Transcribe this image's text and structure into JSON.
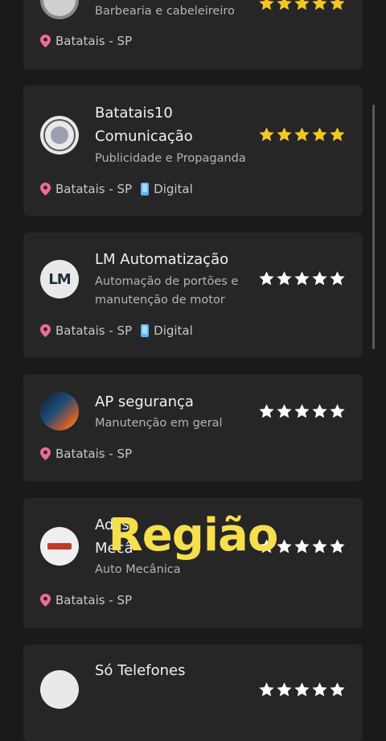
{
  "colors": {
    "background": "#1a1a1b",
    "card": "#262627",
    "star_gold": "#f3c623",
    "star_white": "#ffffff",
    "pin": "#f06a9e",
    "caption": "#f5df4d"
  },
  "listings": [
    {
      "name": "",
      "name_line2": "",
      "category": "Barbearia e cabeleireiro",
      "location": "Batatais - SP",
      "digital": "",
      "rating": 5,
      "star_color": "gold",
      "avatar_icon": "barbershop-logo-icon"
    },
    {
      "name": "Batatais10",
      "name_line2": "Comunicação",
      "category": "Publicidade e Propaganda",
      "location": "Batatais - SP",
      "digital": "Digital",
      "rating": 5,
      "star_color": "gold",
      "avatar_icon": "batatais10-logo-icon"
    },
    {
      "name": "LM Automatização",
      "name_line2": "",
      "category": "Automação de portões e",
      "category_line2": "manutenção de motor",
      "location": "Batatais - SP",
      "digital": "Digital",
      "rating": 5,
      "star_color": "white",
      "avatar_icon": "lm-logo-icon"
    },
    {
      "name": "AP segurança",
      "name_line2": "",
      "category": "Manutenção em geral",
      "location": "Batatais - SP",
      "digital": "",
      "rating": 5,
      "star_color": "white",
      "avatar_icon": "ap-seguranca-logo-icon"
    },
    {
      "name": "Adils",
      "name_line2": "Mecâ",
      "category": "Auto Mecânica",
      "location": "Batatais - SP",
      "digital": "",
      "rating": 5,
      "star_color": "white",
      "avatar_icon": "auto-mecanica-logo-icon"
    },
    {
      "name": "Só Telefones",
      "name_line2": "",
      "category": "",
      "location": "",
      "digital": "",
      "rating": 5,
      "star_color": "white",
      "avatar_icon": "so-telefones-logo-icon"
    }
  ],
  "caption": "Região",
  "avatar_texts": {
    "lm": "LM"
  }
}
